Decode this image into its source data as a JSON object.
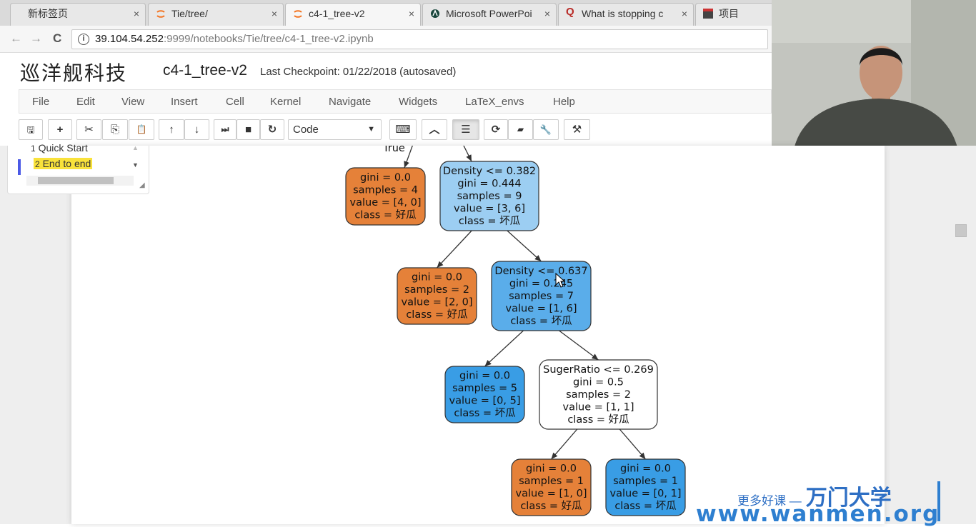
{
  "tabs": [
    {
      "label": "新标签页",
      "icon": "none",
      "active": false
    },
    {
      "label": "Tie/tree/",
      "icon": "jupyter-icon",
      "active": false
    },
    {
      "label": "c4-1_tree-v2",
      "icon": "jupyter-icon",
      "active": true
    },
    {
      "label": "Microsoft PowerPoi",
      "icon": "msu-icon",
      "active": false
    },
    {
      "label": "What is stopping c",
      "icon": "quora-icon",
      "active": false
    },
    {
      "label": "项目",
      "icon": "project-icon",
      "active": false
    }
  ],
  "tab_close": "×",
  "address": {
    "host": "39.104.54.252",
    "path": ":9999/notebooks/Tie/tree/c4-1_tree-v2.ipynb",
    "info": "i"
  },
  "nav": {
    "back": "←",
    "forward": "→",
    "reload": "C"
  },
  "header": {
    "logo": "巡洋舰科技",
    "notebook_name": "c4-1_tree-v2",
    "checkpoint": "Last Checkpoint: 01/22/2018 (autosaved)"
  },
  "menu": [
    "File",
    "Edit",
    "View",
    "Insert",
    "Cell",
    "Kernel",
    "Navigate",
    "Widgets",
    "LaTeX_envs",
    "Help"
  ],
  "toolbar": {
    "buttons": [
      {
        "name": "save-button",
        "glyph": "🖫"
      },
      {
        "name": "insert-cell-button",
        "glyph": "+"
      },
      {
        "name": "cut-button",
        "glyph": "✂"
      },
      {
        "name": "copy-button",
        "glyph": "⎘"
      },
      {
        "name": "paste-button",
        "glyph": "📋"
      },
      {
        "name": "move-up-button",
        "glyph": "↑"
      },
      {
        "name": "move-down-button",
        "glyph": "↓"
      },
      {
        "name": "run-button",
        "glyph": "⏭"
      },
      {
        "name": "interrupt-button",
        "glyph": "■"
      },
      {
        "name": "restart-button",
        "glyph": "↻"
      }
    ],
    "cell_type": "Code",
    "extra_buttons": [
      {
        "name": "keyboard-button",
        "glyph": "⌨"
      },
      {
        "name": "collapse-button",
        "glyph": "︿"
      },
      {
        "name": "toc-toggle-button",
        "glyph": "☰"
      },
      {
        "name": "refresh-button",
        "glyph": "⟳"
      },
      {
        "name": "book-button",
        "glyph": "▰"
      },
      {
        "name": "wrench-button",
        "glyph": "🔧"
      },
      {
        "name": "gavel-button",
        "glyph": "⚒"
      }
    ]
  },
  "toc": {
    "items": [
      {
        "num": "1",
        "label": "Quick Start"
      },
      {
        "num": "2",
        "label": "End to end"
      }
    ]
  },
  "tree": {
    "edge_label_true": "True",
    "nodes": [
      {
        "id": "n1",
        "lines": [
          "gini = 0.0",
          "samples = 4",
          "value = [4, 0]",
          "class = 好瓜"
        ],
        "fill": "#e58139"
      },
      {
        "id": "n2",
        "lines": [
          "Density <= 0.382",
          "gini = 0.444",
          "samples = 9",
          "value = [3, 6]",
          "class = 坏瓜"
        ],
        "fill": "#9ccef2"
      },
      {
        "id": "n3",
        "lines": [
          "gini = 0.0",
          "samples = 2",
          "value = [2, 0]",
          "class = 好瓜"
        ],
        "fill": "#e58139"
      },
      {
        "id": "n4",
        "lines": [
          "Density <= 0.637",
          "gini = 0.245",
          "samples = 7",
          "value = [1, 6]",
          "class = 坏瓜"
        ],
        "fill": "#5aadea"
      },
      {
        "id": "n5",
        "lines": [
          "gini = 0.0",
          "samples = 5",
          "value = [0, 5]",
          "class = 坏瓜"
        ],
        "fill": "#399de5"
      },
      {
        "id": "n6",
        "lines": [
          "SugerRatio <= 0.269",
          "gini = 0.5",
          "samples = 2",
          "value = [1, 1]",
          "class = 好瓜"
        ],
        "fill": "#ffffff"
      },
      {
        "id": "n7",
        "lines": [
          "gini = 0.0",
          "samples = 1",
          "value = [1, 0]",
          "class = 好瓜"
        ],
        "fill": "#e58139"
      },
      {
        "id": "n8",
        "lines": [
          "gini = 0.0",
          "samples = 1",
          "value = [0, 1]",
          "class = 坏瓜"
        ],
        "fill": "#399de5"
      }
    ]
  },
  "watermark": {
    "tagline": "更多好课 —",
    "brand": "万门大学",
    "url": "www.wanmen.org"
  }
}
